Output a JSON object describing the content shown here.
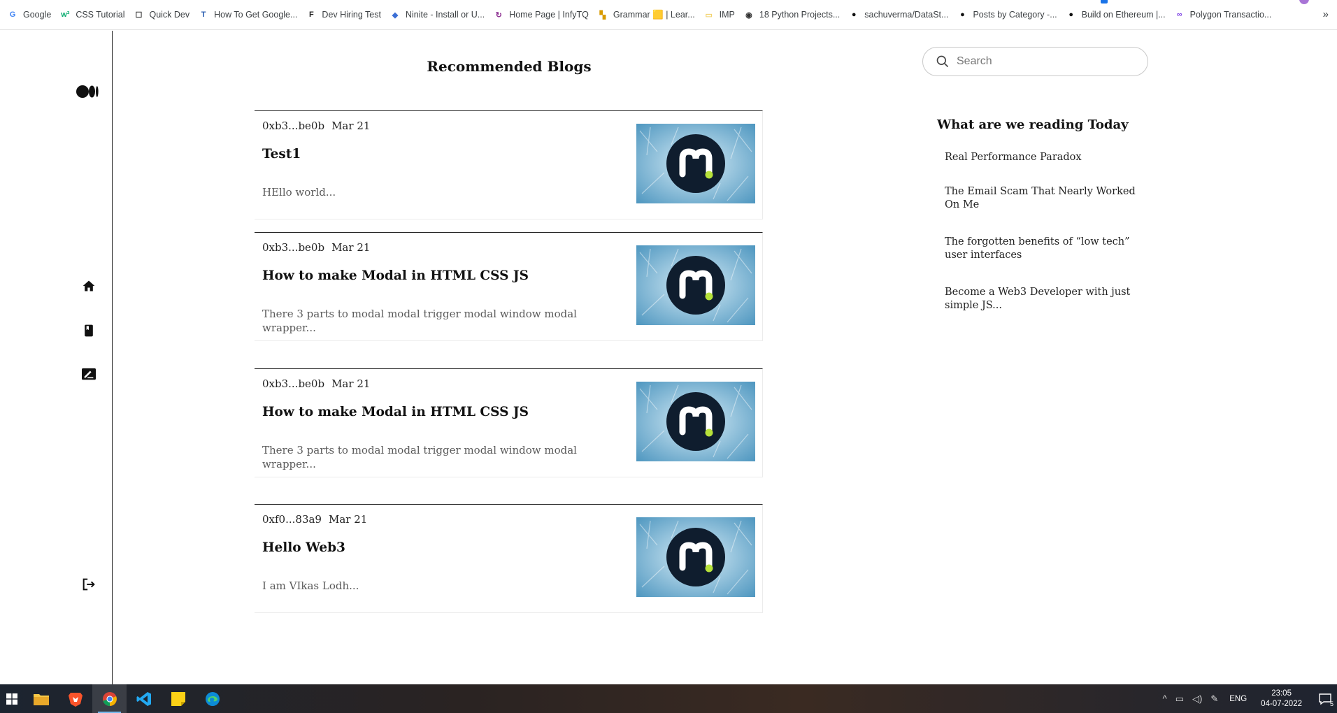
{
  "bookmarks": [
    {
      "label": "Google",
      "icon": "google-icon",
      "glyph": "G",
      "color": "#4285f4"
    },
    {
      "label": "CSS Tutorial",
      "icon": "w3schools-icon",
      "glyph": "w³",
      "color": "#04aa6d"
    },
    {
      "label": "Quick Dev",
      "icon": "page-icon",
      "glyph": "☐",
      "color": "#333333"
    },
    {
      "label": "How To Get Google...",
      "icon": "tutorial-icon",
      "glyph": "T",
      "color": "#2a5db0"
    },
    {
      "label": "Dev Hiring Test",
      "icon": "f-icon",
      "glyph": "F",
      "color": "#222222"
    },
    {
      "label": "Ninite - Install or U...",
      "icon": "ninite-icon",
      "glyph": "◆",
      "color": "#3b6fd6"
    },
    {
      "label": "Home Page | InfyTQ",
      "icon": "infytq-icon",
      "glyph": "↻",
      "color": "#8a2b8f"
    },
    {
      "label": "Grammar 🟨 | Lear...",
      "icon": "grammar-icon",
      "glyph": "▚",
      "color": "#d89b00"
    },
    {
      "label": "IMP",
      "icon": "folder-icon",
      "glyph": "▭",
      "color": "#f2d26b"
    },
    {
      "label": "18 Python Projects...",
      "icon": "python-icon",
      "glyph": "◉",
      "color": "#333333"
    },
    {
      "label": "sachuverma/DataSt...",
      "icon": "github-icon",
      "glyph": "●",
      "color": "#111111"
    },
    {
      "label": "Posts by Category -...",
      "icon": "blog-icon",
      "glyph": "●",
      "color": "#111111"
    },
    {
      "label": "Build on Ethereum |...",
      "icon": "ethereum-icon",
      "glyph": "●",
      "color": "#111111"
    },
    {
      "label": "Polygon Transactio...",
      "icon": "polygon-icon",
      "glyph": "∞",
      "color": "#8247e5"
    }
  ],
  "bookmarks_overflow": "»",
  "sidebar": {
    "logo": "medium-logo-icon",
    "nav": [
      "home-icon",
      "bookmark-icon",
      "write-icon"
    ],
    "logout": "logout-icon"
  },
  "feed": {
    "title": "Recommended Blogs",
    "posts": [
      {
        "author": "0xb3...be0b",
        "date": "Mar 21",
        "title": "Test1",
        "excerpt": "HEllo world..."
      },
      {
        "author": "0xb3...be0b",
        "date": "Mar 21",
        "title": "How to make Modal in HTML CSS JS",
        "excerpt": "There 3 parts to modal modal trigger modal window modal wrapper..."
      },
      {
        "author": "0xb3...be0b",
        "date": "Mar 21",
        "title": "How to make Modal in HTML CSS JS",
        "excerpt": "There 3 parts to modal modal trigger modal window modal wrapper..."
      },
      {
        "author": "0xf0...83a9",
        "date": "Mar 21",
        "title": "Hello Web3",
        "excerpt": "I am VIkas Lodh..."
      }
    ]
  },
  "aside": {
    "search_placeholder": "Search",
    "reading_title": "What are we reading Today",
    "reading": [
      "Real Performance Paradox",
      "The Email Scam That Nearly Worked On Me",
      "The forgotten benefits of “low tech” user interfaces",
      "Become a Web3 Developer with just simple JS..."
    ]
  },
  "taskbar": {
    "apps": [
      "windows-start-icon",
      "file-explorer-icon",
      "brave-icon",
      "chrome-icon",
      "vscode-icon",
      "sticky-notes-icon",
      "edge-icon"
    ],
    "active": "chrome-icon",
    "language": "ENG",
    "time": "23:05",
    "date": "04-07-2022",
    "notifications": "5"
  },
  "colors": {
    "accent": "#1a73e8",
    "thumb_bg": "#8fc3dc",
    "thumb_circle": "#0f1d2e",
    "thumb_dot": "#b7e23a"
  }
}
